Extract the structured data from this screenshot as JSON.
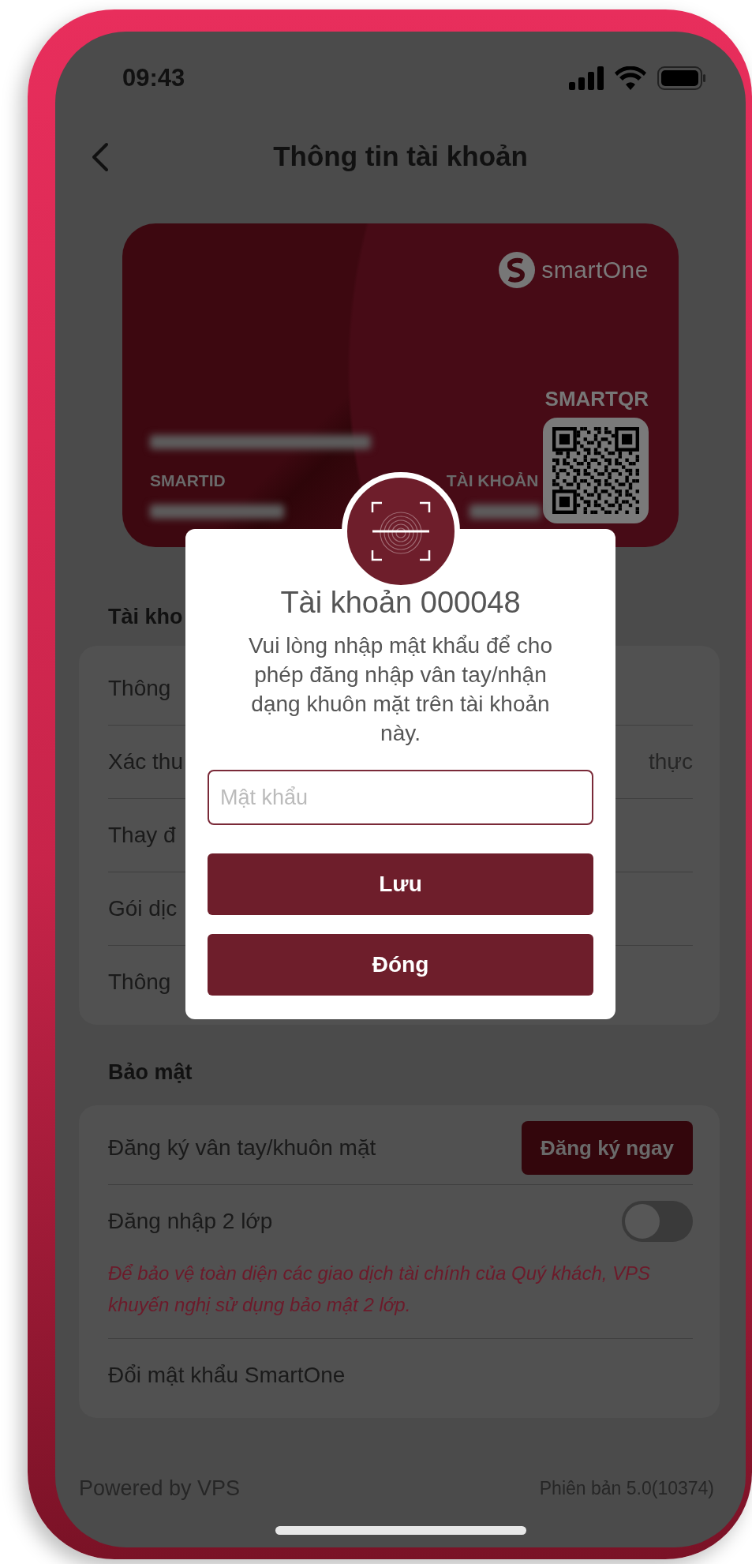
{
  "status_bar": {
    "time": "09:43"
  },
  "header": {
    "title": "Thông tin tài khoản"
  },
  "card": {
    "brand": "smartOne",
    "qr_label": "SMARTQR",
    "id_label": "SMARTID",
    "account_label": "TÀI KHOẢN"
  },
  "sections": [
    {
      "title": "Tài kho",
      "rows": [
        {
          "kind": "link",
          "label": "Thông"
        },
        {
          "kind": "value",
          "label": "Xác thu",
          "value": "thực"
        },
        {
          "kind": "link",
          "label": "Thay đ"
        },
        {
          "kind": "link",
          "label": "Gói dịc"
        },
        {
          "kind": "link",
          "label": "Thông"
        }
      ]
    },
    {
      "title": "Bảo mật",
      "rows": [
        {
          "kind": "button",
          "label": "Đăng ký vân tay/khuôn mặt",
          "button": "Đăng ký ngay"
        },
        {
          "kind": "toggle",
          "label": "Đăng nhập 2 lớp",
          "on": false,
          "note": "Để bảo vệ toàn diện các giao dịch tài chính của Quý khách, VPS khuyến nghị sử dụng bảo mật 2 lớp."
        },
        {
          "kind": "link",
          "label": "Đổi mật khẩu SmartOne"
        }
      ]
    }
  ],
  "footer": {
    "powered": "Powered by VPS",
    "version": "Phiên bản 5.0(10374)"
  },
  "dialog": {
    "title": "Tài khoản 000048",
    "message": "Vui lòng nhập mật khẩu để cho phép đăng nhập vân tay/nhận dạng khuôn mặt trên tài khoản này.",
    "password": {
      "placeholder": "Mật khẩu"
    },
    "buttons": [
      "Lưu",
      "Đóng"
    ]
  }
}
